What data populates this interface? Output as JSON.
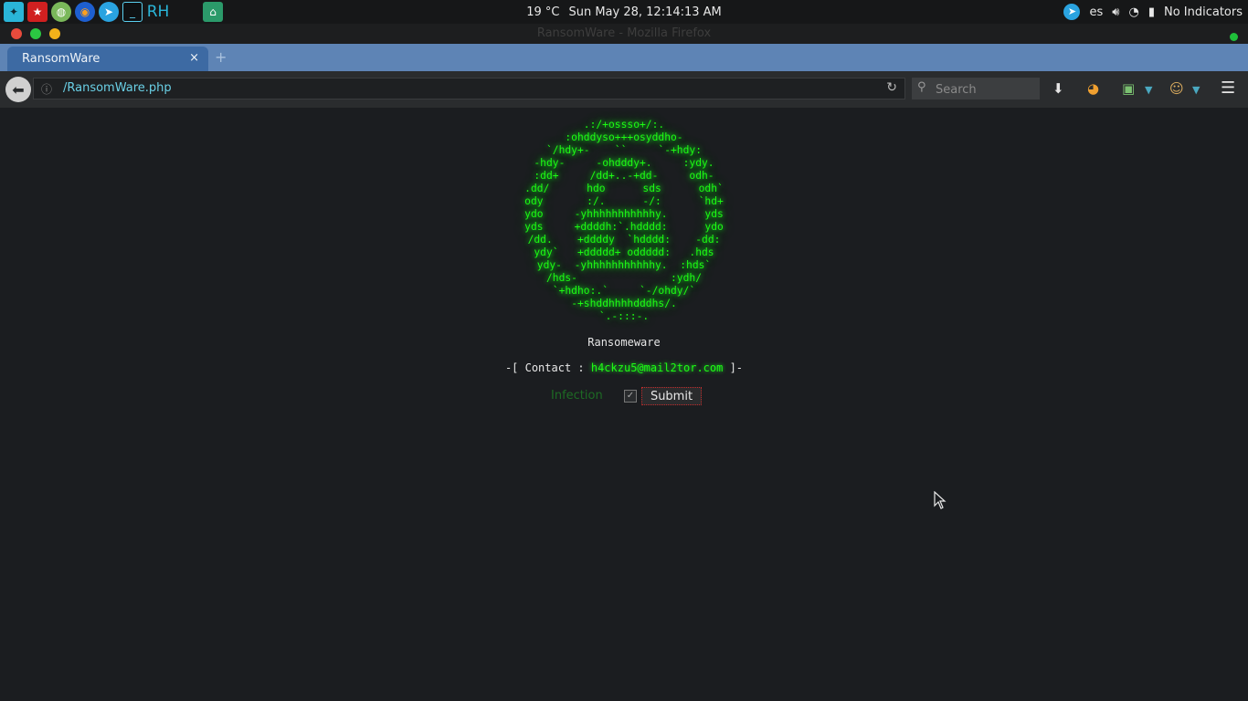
{
  "system_panel": {
    "weather": "19 °C",
    "datetime": "Sun May 28, 12:14:13 AM",
    "keyboard_layout": "es",
    "indicators_label": "No Indicators",
    "launchers": [
      "app-menu-icon",
      "flag-app-icon",
      "globe-app-icon",
      "browser-app-icon",
      "telegram-icon",
      "terminal-icon",
      "rh-app-icon",
      "files-icon"
    ]
  },
  "window": {
    "title": "RansomWare - Mozilla Firefox"
  },
  "browser": {
    "tab_title": "RansomWare",
    "tab_close": "×",
    "new_tab": "+",
    "url": "/RansomWare.php",
    "search_placeholder": "Search"
  },
  "page": {
    "ascii_art": [
      ".:/+ossso+/:.",
      ":ohddyso+++osyddho-",
      "`/hdy+-    ``     `-+hdy:",
      "-hdy-     -ohdddy+.     :ydy.",
      ":dd+     /dd+..-+dd-     odh-",
      ".dd/      hdo      sds      odh`",
      "ody       :/.      -/:      `hd+",
      "ydo     -yhhhhhhhhhhhy.      yds",
      "yds     +ddddh:`.hdddd:      ydo",
      "/dd.    +ddddy  `hdddd:    -dd:",
      "ydy`   +ddddd+ oddddd:   .hds",
      "ydy-  -yhhhhhhhhhhhy.  :hds`",
      "/hds-               :ydh/",
      "`+hdho:.`     `-/ohdy/`",
      "-+shddhhhhdddhs/.",
      "`.-:::-."
    ],
    "title": "Ransomeware",
    "contact_prefix": "-[ Contact : ",
    "contact_email": "h4ckzu5@mail2tor.com",
    "contact_suffix": " ]-",
    "infection_label": "Infection",
    "checkbox_mark": "✓",
    "submit_label": "Submit"
  },
  "colors": {
    "ascii_green": "#1efb14",
    "tab_blue": "#3d6aa3",
    "tabbar_blue": "#5e84b5",
    "background": "#1b1d20"
  }
}
